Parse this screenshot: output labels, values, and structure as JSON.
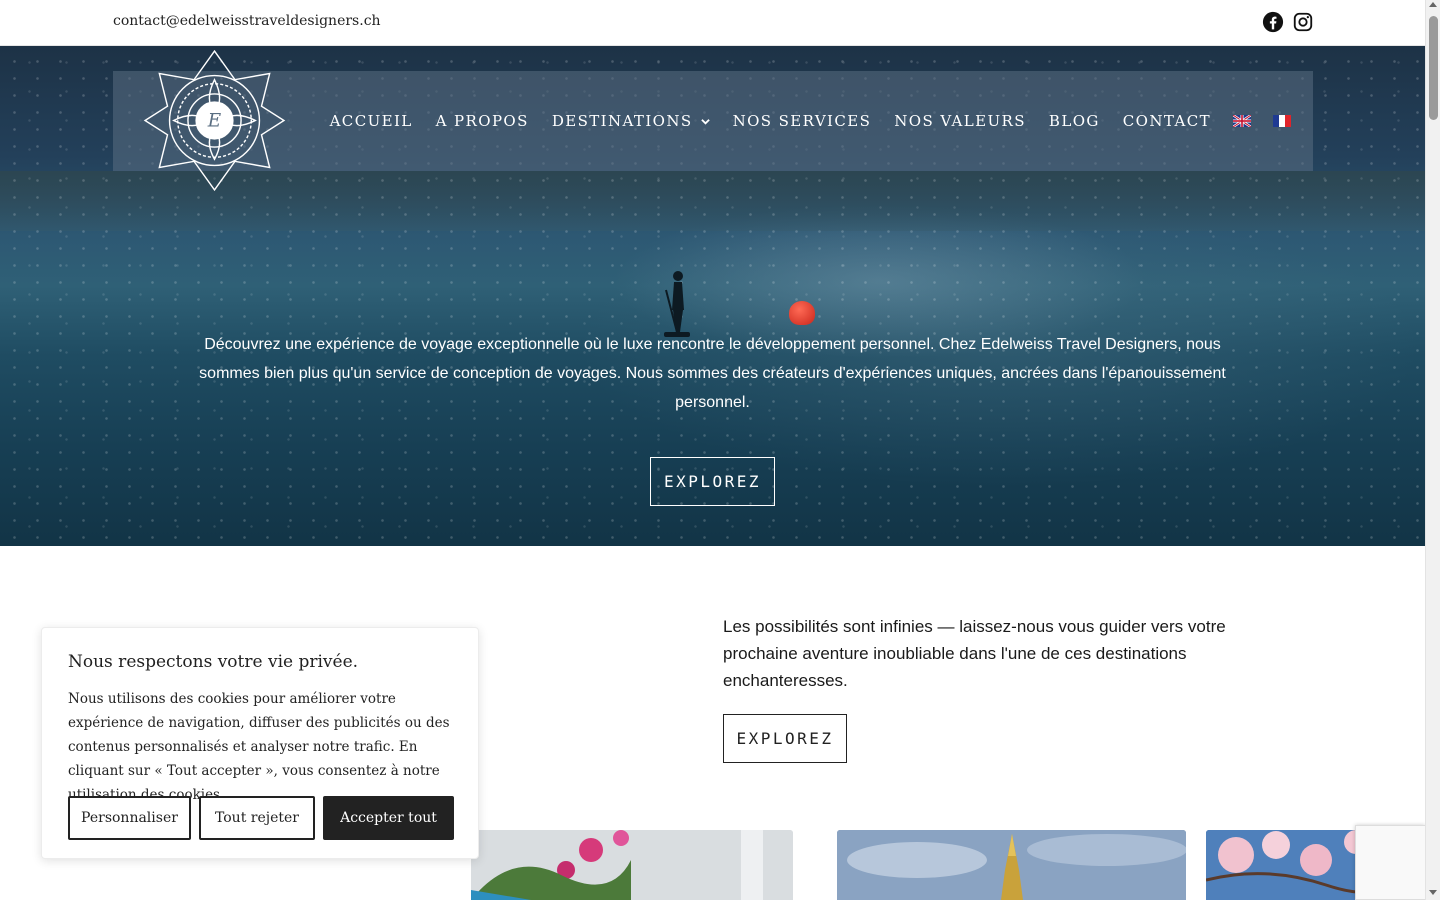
{
  "topbar": {
    "email": "contact@edelweisstraveldesigners.ch",
    "social_icons": [
      "facebook-icon",
      "instagram-icon"
    ]
  },
  "nav": {
    "items": [
      {
        "label": "ACCUEIL"
      },
      {
        "label": "A PROPOS"
      },
      {
        "label": "DESTINATIONS",
        "has_dropdown": true
      },
      {
        "label": "NOS SERVICES"
      },
      {
        "label": "NOS VALEURS"
      },
      {
        "label": "BLOG"
      },
      {
        "label": "CONTACT"
      }
    ],
    "languages": [
      "english-flag-icon",
      "french-flag-icon"
    ]
  },
  "hero": {
    "text": "Découvrez une expérience de voyage exceptionnelle où le luxe rencontre le développement personnel. Chez Edelweiss Travel Designers, nous sommes bien plus qu'un service de conception de voyages. Nous sommes des créateurs d'expériences uniques, ancrées dans l'épanouissement personnel.",
    "button_label": "EXPLOREZ"
  },
  "intro": {
    "text": "Les possibilités sont infinies — laissez-nous vous guider vers votre prochaine aventure inoubliable dans l'une de ces destinations enchanteresses.",
    "button_label": "EXPLOREZ"
  },
  "cookie_banner": {
    "title": "Nous respectons votre vie privée.",
    "body": "Nous utilisons des cookies pour améliorer votre expérience de navigation, diffuser des publicités ou des contenus personnalisés et analyser notre trafic. En cliquant sur « Tout accepter », vous consentez à notre utilisation des cookies.",
    "customize_label": "Personnaliser",
    "reject_label": "Tout rejeter",
    "accept_label": "Accepter tout"
  },
  "colors": {
    "hero_water": "#2d5873",
    "nav_overlay": "#5a6e82",
    "button_dark": "#222222"
  }
}
